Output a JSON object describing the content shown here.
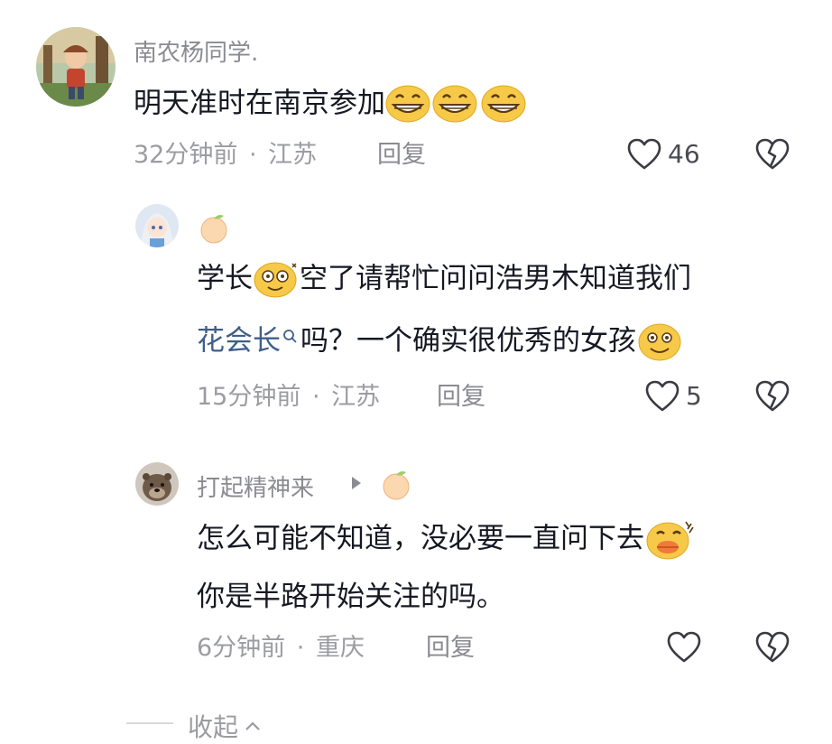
{
  "comments": [
    {
      "user": "南农杨同学.",
      "text": "明天准时在南京参加",
      "time": "32分钟前",
      "location": "江苏",
      "reply_label": "回复",
      "likes": "46",
      "emojis": [
        "grin-emoji",
        "grin-emoji",
        "grin-emoji"
      ]
    },
    {
      "user": "",
      "text_line1_a": "学长",
      "text_line1_b": "空了请帮忙问问浩男木知道我们",
      "link_text": "花会长",
      "text_line2_b": "吗？一个确实很优秀的女孩",
      "time": "15分钟前",
      "location": "江苏",
      "reply_label": "回复",
      "likes": "5"
    },
    {
      "user": "打起精神来",
      "text_line1": "怎么可能不知道，没必要一直问下去",
      "text_line2": "你是半路开始关注的吗。",
      "time": "6分钟前",
      "location": "重庆",
      "reply_label": "回复",
      "likes": ""
    }
  ],
  "separator": "·",
  "collapse_label": "收起",
  "colors": {
    "text": "#161823",
    "meta": "#9b9ca1",
    "link": "#3e5f8a",
    "emoji_yellow": "#f7c948"
  }
}
